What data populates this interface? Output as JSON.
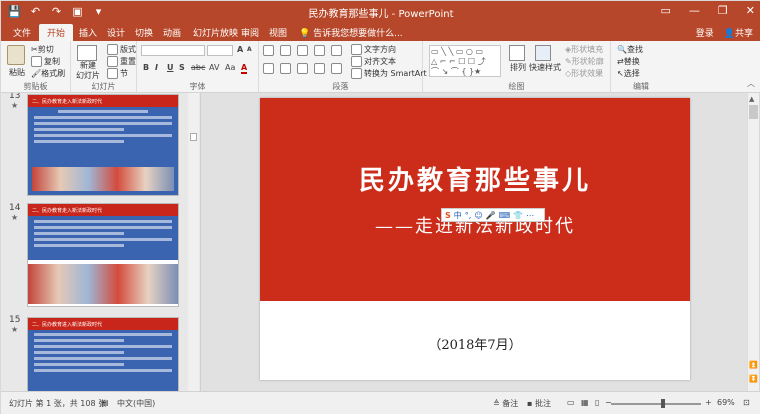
{
  "window": {
    "title": "民办教育那些事儿 - PowerPoint",
    "controls": [
      "▭",
      "—",
      "❐",
      "✕"
    ]
  },
  "qat": [
    "save",
    "undo",
    "redo",
    "start",
    "more"
  ],
  "tabs": [
    "文件",
    "开始",
    "插入",
    "设计",
    "切换",
    "动画",
    "幻灯片放映",
    "审阅",
    "视图"
  ],
  "active_tab": "开始",
  "tell_me": "告诉我您想要做什么...",
  "account": {
    "login": "登录",
    "share": "共享"
  },
  "ribbon": {
    "clipboard": {
      "label": "剪贴板",
      "paste": "粘贴",
      "cut": "剪切",
      "copy": "复制",
      "format_painter": "格式刷"
    },
    "slides": {
      "label": "幻灯片",
      "new_slide": "新建\n幻灯片",
      "layout": "版式",
      "reset": "重置",
      "section": "节"
    },
    "font": {
      "label": "字体",
      "buttons": [
        "B",
        "I",
        "U",
        "S",
        "abc",
        "AV",
        "Aa",
        "A"
      ]
    },
    "paragraph": {
      "label": "段落",
      "text_direction": "文字方向",
      "align_text": "对齐文本",
      "smartart": "转换为 SmartArt"
    },
    "drawing": {
      "label": "绘图",
      "arrange": "排列",
      "quick_styles": "快速样式",
      "shape_fill": "形状填充",
      "shape_outline": "形状轮廓",
      "shape_effects": "形状效果"
    },
    "editing": {
      "label": "编辑",
      "find": "查找",
      "replace": "替换",
      "select": "选择"
    }
  },
  "thumbnails": [
    {
      "num": "13",
      "header": "二、民办教育走入新法新政时代",
      "lines": 9
    },
    {
      "num": "14",
      "header": "二、民办教育走入新法新政时代",
      "lines": 6
    },
    {
      "num": "15",
      "header": "二、民办教育进入新法新政时代",
      "lines": 8
    }
  ],
  "slide": {
    "title": "民办教育那些事儿",
    "subtitle": "——走进新法新政时代",
    "date": "（2018年7月）"
  },
  "ime": {
    "logo": "S",
    "items": [
      "中",
      "°,",
      "☺",
      "🎤",
      "⌨",
      "👕",
      "⋯"
    ]
  },
  "status": {
    "slide_info": "幻灯片 第 1 张，共 108 张",
    "language": "中文(中国)",
    "notes": "备注",
    "comments": "批注",
    "zoom": "69%"
  },
  "colors": {
    "brand": "#b7472a",
    "slide_red": "#cc2c1a",
    "thumb_blue": "#3a63b0"
  }
}
